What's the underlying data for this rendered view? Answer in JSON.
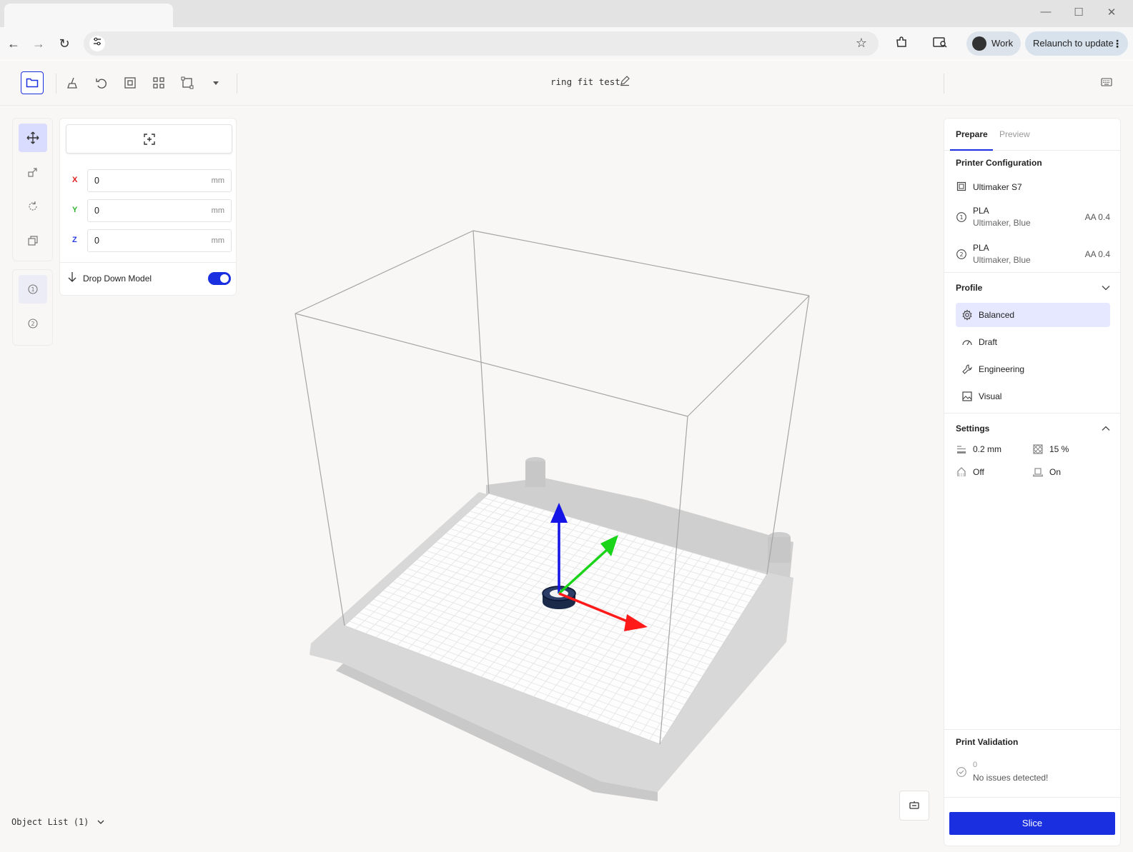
{
  "browser": {
    "tab_title": "",
    "minimize": "—",
    "maximize": "☐",
    "close": "✕",
    "back": "←",
    "forward": "→",
    "reload": "↻",
    "star": "☆",
    "profile_label": "Work",
    "relaunch_label": "Relaunch to update",
    "menu_dots": "⋮"
  },
  "header": {
    "project_title": "ring fit test"
  },
  "move_panel": {
    "x_label": "X",
    "y_label": "Y",
    "z_label": "Z",
    "x_value": "0",
    "y_value": "0",
    "z_value": "0",
    "unit": "mm",
    "drop_down_label": "Drop Down Model",
    "drop_down_enabled": true
  },
  "object_list_label": "Object List (1)",
  "right_panel": {
    "tabs": [
      "Prepare",
      "Preview"
    ],
    "printer_config_title": "Printer Configuration",
    "printer_name": "Ultimaker S7",
    "extruders": [
      {
        "material": "PLA",
        "sub": "Ultimaker, Blue",
        "core": "AA 0.4",
        "index": "1"
      },
      {
        "material": "PLA",
        "sub": "Ultimaker, Blue",
        "core": "AA 0.4",
        "index": "2"
      }
    ],
    "profile_title": "Profile",
    "profiles": [
      "Balanced",
      "Draft",
      "Engineering",
      "Visual"
    ],
    "selected_profile": "Balanced",
    "settings_title": "Settings",
    "layer_height": "0.2 mm",
    "infill": "15 %",
    "support": "Off",
    "adhesion": "On",
    "validation_title": "Print Validation",
    "validation_count": "0",
    "validation_message": "No issues detected!",
    "slice_label": "Slice"
  },
  "colors": {
    "accent": "#1a2fe0",
    "axis_x": "#ff1a1a",
    "axis_y": "#19d419",
    "axis_z": "#1414e6",
    "selected_bg": "#e6e8ff"
  }
}
